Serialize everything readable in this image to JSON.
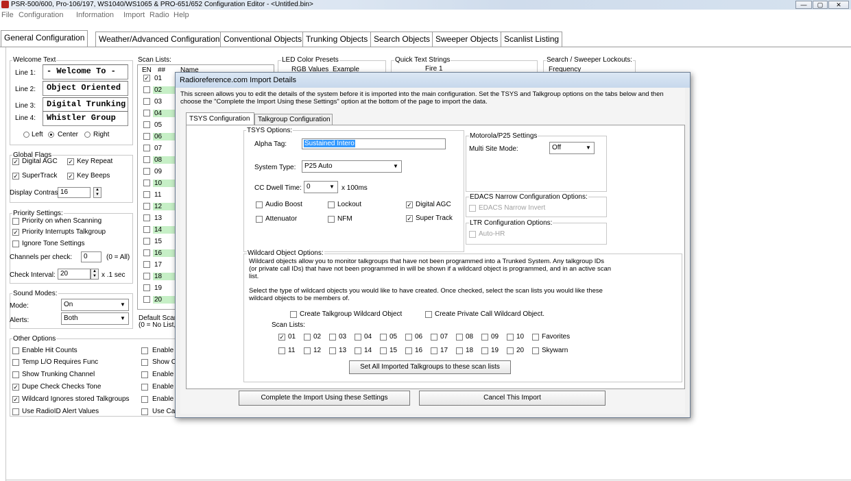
{
  "window": {
    "title": "PSR-500/600, Pro-106/197, WS1040/WS1065 & PRO-651/652 Configuration Editor - <Untitled.bin>",
    "buttons": [
      "—",
      "▢",
      "✕"
    ]
  },
  "menu": [
    "File",
    "Configuration",
    "Information",
    "Import",
    "Radio",
    "Help"
  ],
  "main_tabs": [
    {
      "label": "General Configuration",
      "active": true
    },
    {
      "label": "Weather/Advanced Configuration",
      "active": false
    },
    {
      "label": "Conventional Objects",
      "active": false
    },
    {
      "label": "Trunking Objects",
      "active": false
    },
    {
      "label": "Search Objects",
      "active": false
    },
    {
      "label": "Sweeper Objects",
      "active": false
    },
    {
      "label": "Scanlist Listing",
      "active": false
    }
  ],
  "welcome": {
    "group_label": "Welcome Text",
    "lines": [
      {
        "label": "Line 1:",
        "value": " - Welcome To -"
      },
      {
        "label": "Line 2:",
        "value": "Object Oriented"
      },
      {
        "label": "Line 3:",
        "value": "Digital Trunking"
      },
      {
        "label": "Line 4:",
        "value": " Whistler Group"
      }
    ],
    "align": {
      "left": "Left",
      "center": "Center",
      "right": "Right",
      "selected": "center"
    }
  },
  "global_flags": {
    "group_label": "Global Flags",
    "digital_agc": "Digital AGC",
    "key_repeat": "Key Repeat",
    "supertrack": "SuperTrack",
    "key_beeps": "Key Beeps",
    "contrast_label": "Display Contrast:",
    "contrast_value": "16"
  },
  "priority": {
    "group_label": "Priority Settings:",
    "on_scanning": "Priority on when Scanning",
    "interrupts": "Priority Interrupts Talkgroup",
    "ignore_tone": "Ignore Tone Settings",
    "channels_label": "Channels per check:",
    "channels_value": "0",
    "channels_hint": "(0 = All)",
    "interval_label": "Check Interval:",
    "interval_value": "20",
    "interval_unit": "x .1 sec"
  },
  "sound": {
    "group_label": "Sound Modes:",
    "mode_label": "Mode:",
    "mode_value": "On",
    "alerts_label": "Alerts:",
    "alerts_value": "Both"
  },
  "other": {
    "group_label": "Other Options",
    "col1": [
      {
        "label": "Enable Hit Counts",
        "checked": false
      },
      {
        "label": "Temp L/O Requires Func",
        "checked": false
      },
      {
        "label": "Show Trunking Channel",
        "checked": false
      },
      {
        "label": "Dupe Check Checks Tone",
        "checked": true
      },
      {
        "label": "Wildcard Ignores stored Talkgroups",
        "checked": true
      },
      {
        "label": "Use RadioID Alert Values",
        "checked": false
      }
    ],
    "col2": [
      "Enable",
      "Show C",
      "Enable",
      "Enable",
      "Enable",
      "Use Ca"
    ]
  },
  "scan_lists": {
    "group_label": "Scan Lists:",
    "headers": [
      "EN",
      "##",
      "Name"
    ],
    "rows": [
      "01",
      "02",
      "03",
      "04",
      "05",
      "06",
      "07",
      "08",
      "09",
      "10",
      "11",
      "12",
      "13",
      "14",
      "15",
      "16",
      "17",
      "18",
      "19",
      "20"
    ],
    "default_label": "Default Scan",
    "default_hint": "(0 = No List,"
  },
  "led": {
    "group_label": "LED Color Presets",
    "col1": "RGB Values",
    "col2": "Example"
  },
  "quick_text": {
    "group_label": "Quick Text Strings",
    "first": "Fire 1"
  },
  "lockouts": {
    "group_label": "Search / Sweeper Lockouts:",
    "col1": "Frequency"
  },
  "dialog": {
    "title": "Radioreference.com Import Details",
    "description": "This screen allows you to edit the details of the system before it is imported into the main configuration.  Set the TSYS and Talkgroup options on the tabs below and then choose the \"Complete the Import Using these Settings\" option at the bottom of the page to import the data.",
    "tabs": [
      "TSYS Configuration",
      "Talkgroup Configuration"
    ],
    "tsys": {
      "group_label": "TSYS Options:",
      "alpha_label": "Alpha Tag:",
      "alpha_value": "Sustained Intero",
      "system_type_label": "System Type:",
      "system_type_value": "P25 Auto",
      "cc_dwell_label": "CC Dwell Time:",
      "cc_dwell_value": "0",
      "cc_dwell_unit": "x 100ms",
      "audio_boost": "Audio Boost",
      "lockout": "Lockout",
      "digital_agc": "Digital AGC",
      "attenuator": "Attenuator",
      "nfm": "NFM",
      "super_track": "Super Track"
    },
    "motorola": {
      "group_label": "Motorola/P25 Settings",
      "multi_site_label": "Multi Site Mode:",
      "multi_site_value": "Off"
    },
    "edacs": {
      "group_label": "EDACS Narrow Configuration Options:",
      "invert": "EDACS Narrow Invert"
    },
    "ltr": {
      "group_label": "LTR Configuration Options:",
      "autohr": "Auto-HR"
    },
    "wildcard": {
      "group_label": "Wildcard Object Options:",
      "text1": "Wildcard objects allow you to monitor talkgroups that have not been programmed into a Trunked System.  Any talkgroup IDs  (or private call IDs) that have not been programmed in will be shown if a wildcard object is programmed, and in an active scan list.",
      "text2": "Select the type of wildcard objects you would like to have created.  Once checked, select the scan lists you would like these wildcard objects to be members of.",
      "create_tg": "Create Talkgroup Wildcard Object",
      "create_pc": "Create Private Call Wildcard Object.",
      "scan_lists_label": "Scan Lists:",
      "row1": [
        {
          "label": "01",
          "checked": true
        },
        {
          "label": "02",
          "checked": false
        },
        {
          "label": "03",
          "checked": false
        },
        {
          "label": "04",
          "checked": false
        },
        {
          "label": "05",
          "checked": false
        },
        {
          "label": "06",
          "checked": false
        },
        {
          "label": "07",
          "checked": false
        },
        {
          "label": "08",
          "checked": false
        },
        {
          "label": "09",
          "checked": false
        },
        {
          "label": "10",
          "checked": false
        },
        {
          "label": "Favorites",
          "checked": false
        }
      ],
      "row2": [
        {
          "label": "11",
          "checked": false
        },
        {
          "label": "12",
          "checked": false
        },
        {
          "label": "13",
          "checked": false
        },
        {
          "label": "14",
          "checked": false
        },
        {
          "label": "15",
          "checked": false
        },
        {
          "label": "16",
          "checked": false
        },
        {
          "label": "17",
          "checked": false
        },
        {
          "label": "18",
          "checked": false
        },
        {
          "label": "19",
          "checked": false
        },
        {
          "label": "20",
          "checked": false
        },
        {
          "label": "Skywarn",
          "checked": false
        }
      ],
      "set_all_button": "Set All Imported Talkgroups to these scan lists"
    },
    "complete_button": "Complete the Import Using these Settings",
    "cancel_button": "Cancel This Import"
  }
}
